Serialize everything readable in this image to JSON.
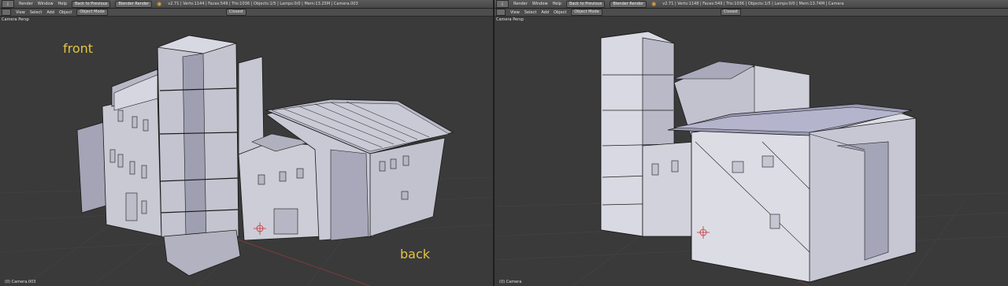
{
  "left": {
    "menu": [
      "Render",
      "Window",
      "Help"
    ],
    "back_button": "Back to Previous",
    "render_engine": "Blender Render",
    "stats": "v2.71 | Verts:1144 | Faces:549 | Tris:1036 | Objects:1/5 | Lamps:0/0 | Mem:13.25M | Camera.003",
    "header_menu": [
      "View",
      "Select",
      "Add",
      "Object"
    ],
    "mode": "Object Mode",
    "orientation": "Closest",
    "view_label": "Camera Persp",
    "object_label": "(0) Camera.003",
    "annotation_front": "front",
    "annotation_back": "back"
  },
  "right": {
    "menu": [
      "Render",
      "Window",
      "Help"
    ],
    "back_button": "Back to Previous",
    "render_engine": "Blender Render",
    "stats": "v2.71 | Verts:1148 | Faces:549 | Tris:1036 | Objects:1/5 | Lamps:0/0 | Mem:13.74M | Camera",
    "header_menu": [
      "View",
      "Select",
      "Add",
      "Object"
    ],
    "mode": "Object Mode",
    "orientation": "Closest",
    "view_label": "Camera Persp",
    "object_label": "(0) Camera"
  },
  "colors": {
    "wall": "#d3d3de",
    "shade": "#9d9db0",
    "edge": "#1a1a1a",
    "bg": "#3a3a3a",
    "annotation": "#e3c441"
  }
}
